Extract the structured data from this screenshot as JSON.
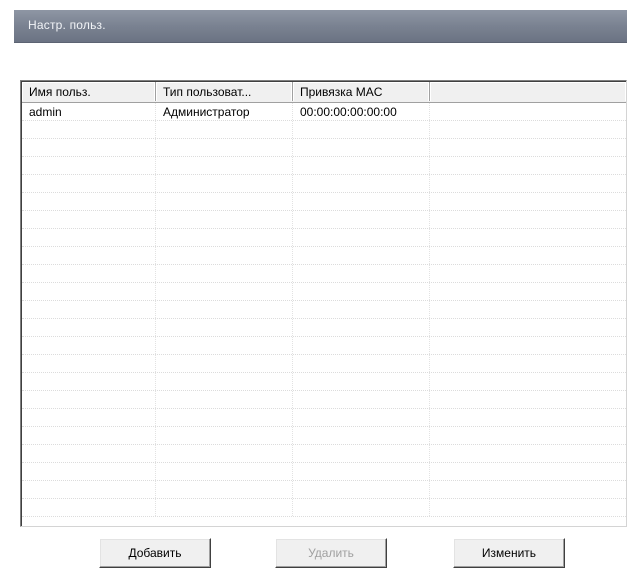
{
  "window": {
    "title": "Настр. польз."
  },
  "table": {
    "columns": [
      "Имя польз.",
      "Тип пользоват...",
      "Привязка MAC",
      ""
    ],
    "rows": [
      {
        "name": "admin",
        "type": "Администратор",
        "mac": "00:00:00:00:00:00"
      }
    ]
  },
  "buttons": {
    "add_label": "Добавить",
    "delete_label": "Удалить",
    "edit_label": "Изменить",
    "delete_disabled": true
  },
  "colors": {
    "titlebar": "#7a8291",
    "title_text": "#f2f4f7",
    "disabled_text": "#a0a0a0"
  }
}
